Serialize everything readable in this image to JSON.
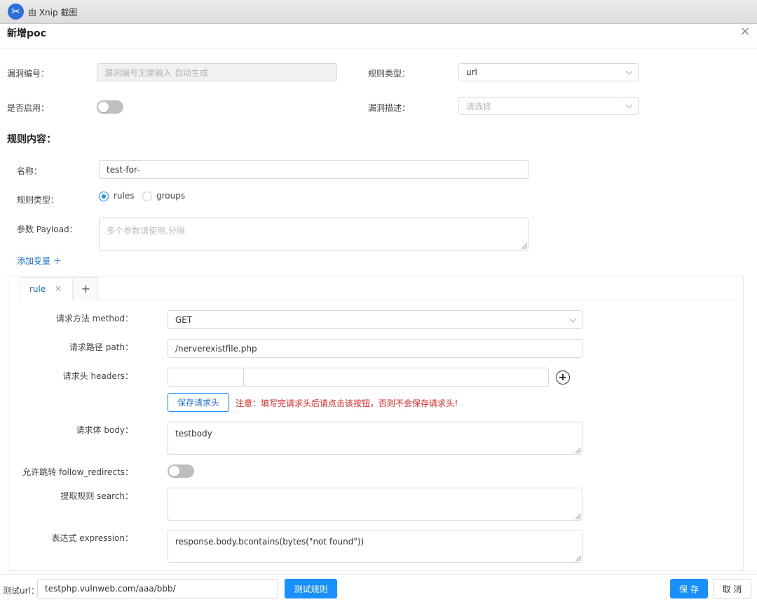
{
  "window": {
    "title": "由 Xnip 截图",
    "app_icon": "xnip-icon"
  },
  "dialog": {
    "title": "新增poc"
  },
  "form": {
    "vuln_id": {
      "label": "漏洞编号：",
      "placeholder": "漏洞编号无需输入 自动生成"
    },
    "rule_type_top": {
      "label": "规则类型：",
      "value": "url"
    },
    "enabled": {
      "label": "是否启用：",
      "on": false
    },
    "vuln_desc": {
      "label": "漏洞描述：",
      "placeholder": "请选择"
    }
  },
  "rule_content": {
    "title": "规则内容：",
    "name": {
      "label": "名称：",
      "value": "test-for-"
    },
    "rule_type": {
      "label": "规则类型：",
      "options": [
        "rules",
        "groups"
      ],
      "selected": "rules"
    },
    "payload": {
      "label": "参数 Payload：",
      "placeholder": "多个参数请使用,分隔"
    },
    "add_variable": "添加变量 ＋"
  },
  "tabs": [
    {
      "label": "rule",
      "close": "×"
    }
  ],
  "tab_add": "+",
  "rule": {
    "method": {
      "label": "请求方法 method：",
      "value": "GET"
    },
    "path": {
      "label": "请求路径 path：",
      "value": "/nerverexistfile.php"
    },
    "headers": {
      "label": "请求头 headers：",
      "key": "",
      "value": ""
    },
    "save_headers_button": "保存请求头",
    "warning": "注意：填写完请求头后请点击该按钮，否则不会保存请求头！",
    "body": {
      "label": "请求体 body：",
      "value": "testbody"
    },
    "follow_redirects": {
      "label": "允许跳转 follow_redirects：",
      "on": false
    },
    "search": {
      "label": "提取规则 search：",
      "value": ""
    },
    "expression": {
      "label": "表达式 expression：",
      "value": "response.body.bcontains(bytes(\"not found\"))"
    }
  },
  "footer": {
    "test_url_label": "测试url：",
    "test_url_value": "testphp.vulnweb.com/aaa/bbb/",
    "test_button": "测试规则",
    "save_button": "保 存",
    "cancel_button": "取 消"
  },
  "colors": {
    "primary": "#1890ff",
    "warning": "#e02424",
    "link": "#1d6fd1"
  }
}
